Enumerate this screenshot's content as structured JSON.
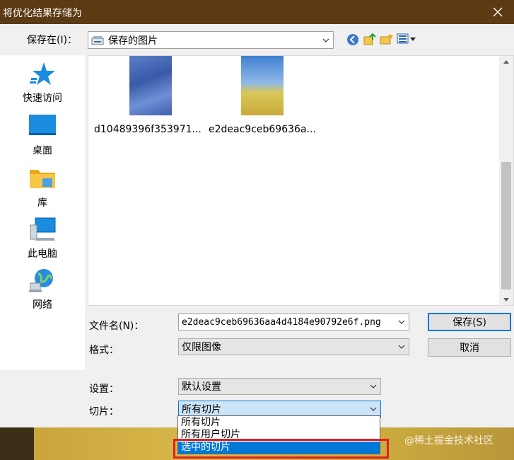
{
  "window": {
    "title": "将优化结果存储为"
  },
  "toolbar": {
    "save_in_label": "保存在(I)：",
    "save_in_value": "保存的图片"
  },
  "places": [
    {
      "label": "快速访问",
      "icon": "quick-access-star-icon"
    },
    {
      "label": "桌面",
      "icon": "desktop-icon"
    },
    {
      "label": "库",
      "icon": "library-folder-icon"
    },
    {
      "label": "此电脑",
      "icon": "computer-icon"
    },
    {
      "label": "网络",
      "icon": "network-globe-icon"
    }
  ],
  "files": [
    {
      "name": "d10489396f353971..."
    },
    {
      "name": "e2deac9ceb69636a..."
    }
  ],
  "form": {
    "filename_label": "文件名(N)：",
    "filename_value": "e2deac9ceb69636aa4d4184e90792e6f.png",
    "format_label": "格式：",
    "format_value": "仅限图像",
    "settings_label": "设置：",
    "settings_value": "默认设置",
    "slices_label": "切片：",
    "slices_value": "所有切片",
    "slices_options": [
      "所有切片",
      "所有用户切片",
      "选中的切片"
    ]
  },
  "buttons": {
    "save": "保存(S)",
    "cancel": "取消"
  },
  "watermark": "@稀土掘金技术社区",
  "colors": {
    "titlebar": "#5b3a14",
    "accent": "#0078d7",
    "highlight": "#e02020"
  }
}
